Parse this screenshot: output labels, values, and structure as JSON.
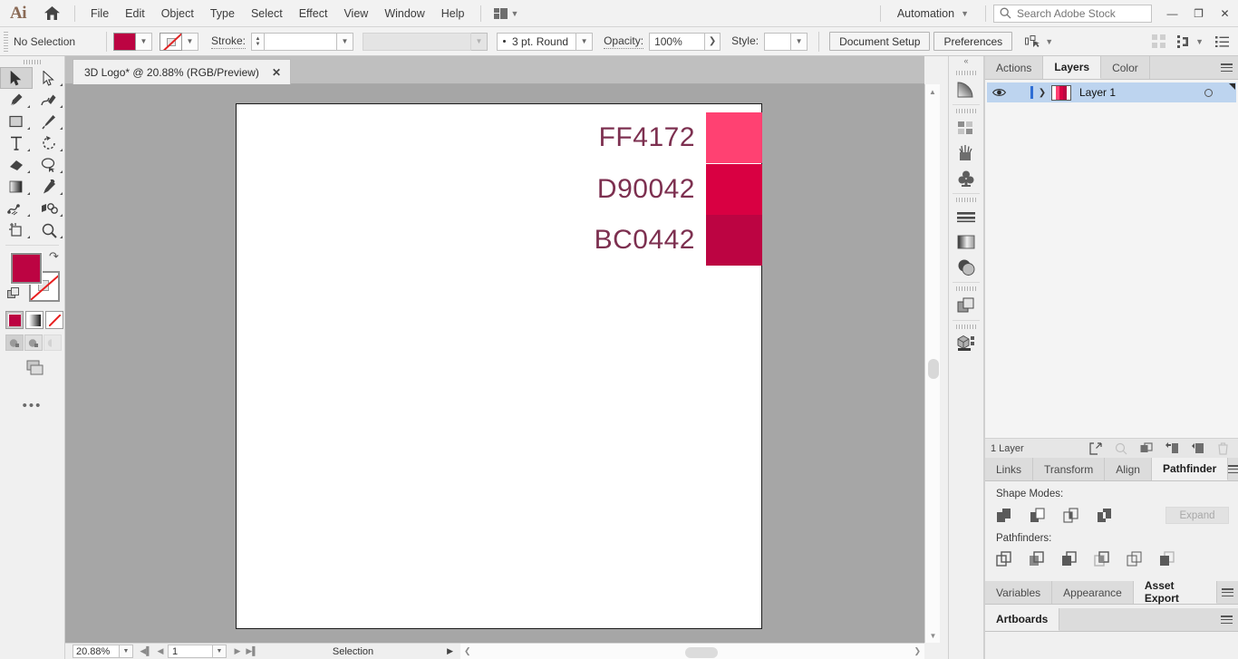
{
  "app": {
    "logo": "Ai",
    "home_icon": "home-icon"
  },
  "menubar": {
    "items": [
      "File",
      "Edit",
      "Object",
      "Type",
      "Select",
      "Effect",
      "View",
      "Window",
      "Help"
    ],
    "workspace_switcher_icon": "workspace-grid-icon",
    "automation_label": "Automation",
    "search_placeholder": "Search Adobe Stock",
    "search_value": "",
    "window_buttons": {
      "minimize": "—",
      "restore": "❐",
      "close": "✕"
    }
  },
  "controlbar": {
    "selection_label": "No Selection",
    "fill_color": "#BC0442",
    "stroke_color": "none",
    "stroke_label": "Stroke:",
    "stroke_weight": "",
    "profile_value": "",
    "brush_definition": "3 pt. Round",
    "opacity_label": "Opacity:",
    "opacity_value": "100%",
    "style_label": "Style:",
    "document_setup": "Document Setup",
    "preferences": "Preferences",
    "right_icons": [
      "align-icon",
      "transform-icon",
      "chevron-down-icon",
      "list-icon"
    ]
  },
  "toolbar": {
    "tools": [
      {
        "name": "selection-tool",
        "selected": true
      },
      {
        "name": "direct-selection-tool",
        "selected": false
      },
      {
        "name": "pen-tool",
        "selected": false
      },
      {
        "name": "curvature-tool",
        "selected": false
      },
      {
        "name": "rectangle-tool",
        "selected": false
      },
      {
        "name": "paintbrush-tool",
        "selected": false
      },
      {
        "name": "type-tool",
        "selected": false
      },
      {
        "name": "rotate-tool",
        "selected": false
      },
      {
        "name": "eraser-tool",
        "selected": false
      },
      {
        "name": "lasso-tool",
        "selected": false
      },
      {
        "name": "gradient-tool",
        "selected": false
      },
      {
        "name": "eyedropper-tool",
        "selected": false
      },
      {
        "name": "blend-tool",
        "selected": false
      },
      {
        "name": "symbol-sprayer-tool",
        "selected": false
      },
      {
        "name": "artboard-tool",
        "selected": false
      },
      {
        "name": "zoom-tool",
        "selected": false
      }
    ],
    "fill_color": "#BC0442",
    "stroke_color": "none",
    "fill_stroke_modes": [
      "color-mode",
      "gradient-mode",
      "none-mode"
    ],
    "screen_modes": [
      "normal-screen-mode",
      "full-screen-menu-mode",
      "full-screen-mode"
    ],
    "more_tools": "•••"
  },
  "document": {
    "tab_title": "3D Logo* @ 20.88% (RGB/Preview)",
    "close_label": "✕"
  },
  "artboard": {
    "swatches": [
      {
        "hex_label": "FF4172",
        "color": "#FF4172"
      },
      {
        "hex_label": "D90042",
        "color": "#D90042"
      },
      {
        "hex_label": "BC0442",
        "color": "#BC0442"
      }
    ],
    "label_color": "#7d3050"
  },
  "statusbar": {
    "zoom_level": "20.88%",
    "first_page_icon": "first-page-icon",
    "prev_page_icon": "prev-page-icon",
    "artboard_number": "1",
    "next_page_icon": "next-page-icon",
    "last_page_icon": "last-page-icon",
    "status_text": "Selection",
    "status_arrow": "▶"
  },
  "rail": {
    "collapse_icon": "collapse-panels-icon",
    "icons": [
      "gradient-panel-icon",
      "swatches-panel-icon",
      "brushes-panel-icon",
      "symbols-panel-icon",
      "stroke-panel-icon",
      "gradient2-panel-icon",
      "transparency-panel-icon",
      "pathfinder-panel-icon",
      "3d-panel-icon"
    ]
  },
  "panels": {
    "group1": {
      "tabs": [
        {
          "label": "Actions",
          "active": false
        },
        {
          "label": "Layers",
          "active": true
        },
        {
          "label": "Color",
          "active": false
        }
      ],
      "menu_icon": "panel-menu-icon",
      "layers": [
        {
          "visible_icon": "eye-icon",
          "expand_icon": "chevron-right-icon",
          "thumbnail_colors": [
            "#ffffff",
            "#FF4172",
            "#D90042",
            "#BC0442",
            "#ffffff"
          ],
          "name": "Layer 1",
          "target_icon": "target-circle-icon",
          "selected": true
        }
      ],
      "footer_text": "1 Layer",
      "footer_icons": [
        "locate-object-icon",
        "make-clipping-mask-icon",
        "new-sublayer-icon",
        "collect-in-new-layer-icon",
        "new-layer-icon",
        "delete-layer-icon"
      ]
    },
    "group2": {
      "tabs": [
        {
          "label": "Links",
          "active": false
        },
        {
          "label": "Transform",
          "active": false
        },
        {
          "label": "Align",
          "active": false
        },
        {
          "label": "Pathfinder",
          "active": true
        }
      ],
      "menu_icon": "panel-menu-icon",
      "shape_modes_label": "Shape Modes:",
      "shape_modes": [
        "unite-icon",
        "minus-front-icon",
        "intersect-icon",
        "exclude-icon"
      ],
      "expand_label": "Expand",
      "pathfinders_label": "Pathfinders:",
      "pathfinders": [
        "divide-icon",
        "trim-icon",
        "merge-icon",
        "crop-icon",
        "outline-icon",
        "minus-back-icon"
      ]
    },
    "group3": {
      "tabs": [
        {
          "label": "Variables",
          "active": false
        },
        {
          "label": "Appearance",
          "active": false
        },
        {
          "label": "Asset Export",
          "active": true
        }
      ],
      "menu_icon": "panel-menu-icon"
    },
    "group4": {
      "tabs": [
        {
          "label": "Artboards",
          "active": true
        }
      ],
      "menu_icon": "panel-menu-icon"
    }
  }
}
